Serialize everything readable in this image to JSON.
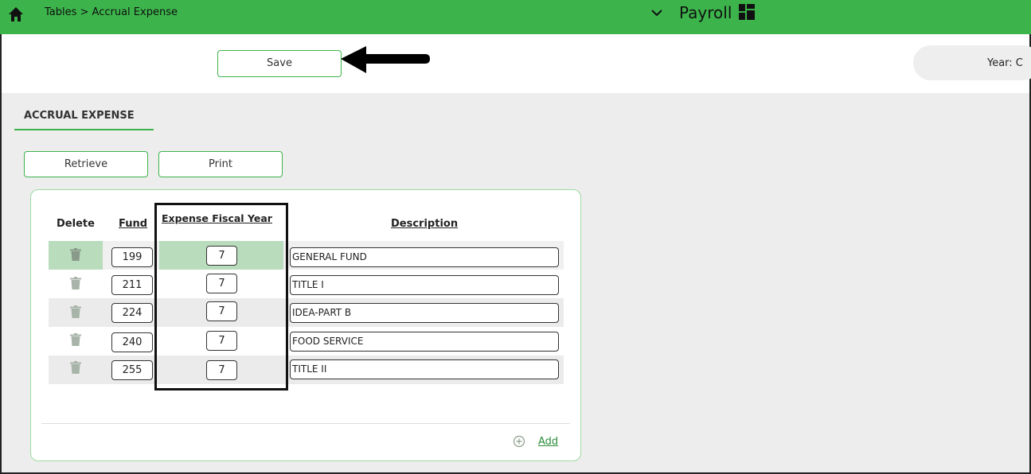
{
  "header": {
    "breadcrumb": "Tables > Accrual Expense",
    "app_title": "Payroll",
    "bar_color": "#3cb44b"
  },
  "toolbar": {
    "save_label": "Save",
    "year_label": "Year: C"
  },
  "section": {
    "title": "ACCRUAL EXPENSE"
  },
  "actions": {
    "retrieve_label": "Retrieve",
    "print_label": "Print",
    "add_label": "Add"
  },
  "table": {
    "columns": {
      "delete": "Delete",
      "fund": "Fund",
      "fiscal_year": "Expense Fiscal Year",
      "description": "Description"
    },
    "rows": [
      {
        "fund": "199",
        "fiscal_year": "7",
        "description": "GENERAL FUND"
      },
      {
        "fund": "211",
        "fiscal_year": "7",
        "description": "TITLE I"
      },
      {
        "fund": "224",
        "fiscal_year": "7",
        "description": "IDEA-PART B"
      },
      {
        "fund": "240",
        "fiscal_year": "7",
        "description": "FOOD SERVICE"
      },
      {
        "fund": "255",
        "fiscal_year": "7",
        "description": "TITLE II"
      }
    ]
  },
  "icons": {
    "home": "home-icon",
    "chevron": "chevron-down-icon",
    "apps": "grid-icon",
    "delete": "trash-icon",
    "add": "plus-circle-icon"
  }
}
